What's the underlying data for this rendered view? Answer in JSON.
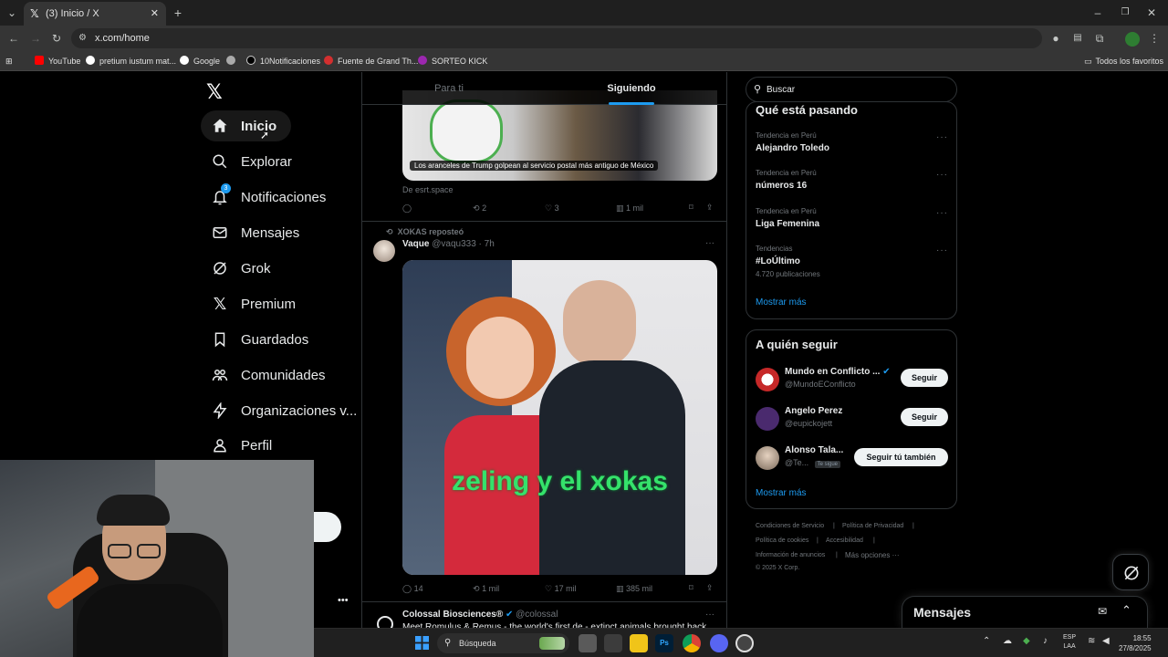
{
  "browser": {
    "tab_title": "(3) Inicio / X",
    "url": "x.com/home",
    "bookmarks": [
      "YouTube",
      "pretium iustum mat...",
      "Google",
      "10Notificaciones",
      "Fuente de Grand Th...",
      "SORTEO KICK"
    ],
    "all_bookmarks": "Todos los favoritos"
  },
  "nav": {
    "items": [
      {
        "label": "Inicio",
        "icon": "home-icon"
      },
      {
        "label": "Explorar",
        "icon": "search-icon"
      },
      {
        "label": "Notificaciones",
        "icon": "bell-icon",
        "badge": "3"
      },
      {
        "label": "Mensajes",
        "icon": "mail-icon"
      },
      {
        "label": "Grok",
        "icon": "grok-icon"
      },
      {
        "label": "Premium",
        "icon": "x-icon"
      },
      {
        "label": "Guardados",
        "icon": "bookmark-icon"
      },
      {
        "label": "Comunidades",
        "icon": "people-icon"
      },
      {
        "label": "Organizaciones v...",
        "icon": "lightning-icon"
      },
      {
        "label": "Perfil",
        "icon": "person-icon"
      }
    ]
  },
  "timeline": {
    "tabs": [
      "Para ti",
      "Siguiendo"
    ],
    "active_tab": "Siguiendo",
    "tweet1": {
      "image_caption": "Los aranceles de Trump golpean al servicio postal más antiguo de México",
      "source": "De esrt.space",
      "reposts": "2",
      "likes": "3",
      "views": "1 mil"
    },
    "tweet2": {
      "repost_label": "XOKAS reposteó",
      "name": "Vaque",
      "handle": "@vaqu333 · 7h",
      "image_text": "zeling y el xokas",
      "replies": "14",
      "reposts": "1 mil",
      "likes": "17 mil",
      "views": "385 mil"
    },
    "tweet3": {
      "name": "Colossal Biosciences®",
      "handle": "@colossal",
      "text": "Meet Romulus & Remus - the world's first de - extinct animals brought back"
    }
  },
  "search": {
    "placeholder": "Buscar"
  },
  "trends": {
    "title": "Qué está pasando",
    "items": [
      {
        "category": "Tendencia en Perú",
        "name": "Alejandro Toledo",
        "count": ""
      },
      {
        "category": "Tendencia en Perú",
        "name": "números 16",
        "count": ""
      },
      {
        "category": "Tendencia en Perú",
        "name": "Liga Femenina",
        "count": ""
      },
      {
        "category": "Tendencias",
        "name": "#LoÚltimo",
        "count": "4.720 publicaciones"
      }
    ],
    "show_more": "Mostrar más"
  },
  "who_to_follow": {
    "title": "A quién seguir",
    "items": [
      {
        "name": "Mundo en Conflicto ...",
        "handle": "@MundoEConflicto",
        "button": "Seguir",
        "badge": ""
      },
      {
        "name": "Angelo Perez",
        "handle": "@eupickojett",
        "button": "Seguir",
        "badge": ""
      },
      {
        "name": "Alonso Tala...",
        "handle": "@Te...",
        "button": "Seguir tú también",
        "badge": "Te sigue"
      }
    ],
    "show_more": "Mostrar más"
  },
  "footer": {
    "links": [
      "Condiciones de Servicio",
      "Política de Privacidad",
      "Política de cookies",
      "Accesibilidad",
      "Información de anuncios",
      "Más opciones ···"
    ],
    "copyright": "© 2025 X Corp."
  },
  "messages_drawer": {
    "title": "Mensajes"
  },
  "taskbar": {
    "search": "Búsqueda",
    "lang": "ESP",
    "lang2": "LAA",
    "time": "18:55",
    "date": "27/8/2025"
  }
}
